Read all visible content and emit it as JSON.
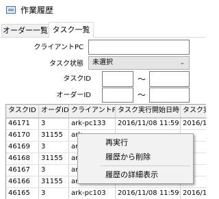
{
  "window": {
    "title": "作業履歴",
    "icon": "window-app-icon"
  },
  "tabs": [
    {
      "label": "オーダー一覧",
      "active": false
    },
    {
      "label": "タスク一覧",
      "active": true
    }
  ],
  "filters": {
    "client_pc_label": "クライアントPC",
    "client_pc_value": "",
    "task_status_label": "タスク状態",
    "task_status_value": "未選択",
    "task_id_label": "タスクID",
    "order_id_label": "オーダーID",
    "range_separator": "～",
    "task_id_from": "",
    "task_id_to": "",
    "order_id_from": "",
    "order_id_to": ""
  },
  "grid": {
    "columns": [
      "タスクID",
      "オーダID",
      "クライアントPC",
      "タスク実行開始日時",
      "タスク実行"
    ],
    "rows": [
      [
        "46171",
        "3",
        "ark-pc133",
        "2016/11/08 11:59:29",
        "2016/11/0"
      ],
      [
        "46170",
        "31155",
        "ark-",
        "",
        ""
      ],
      [
        "46169",
        "3",
        "ark-",
        "",
        ""
      ],
      [
        "46168",
        "31155",
        "ark-",
        "",
        ""
      ],
      [
        "46167",
        "3",
        "ark-",
        "",
        ""
      ],
      [
        "46166",
        "31155",
        "ark-",
        "",
        ""
      ],
      [
        "46165",
        "3",
        "ark-pc103",
        "2016/11/08 11:59:29",
        "2016/11/0"
      ]
    ]
  },
  "context_menu": {
    "items": [
      "再実行",
      "履歴から削除",
      "履歴の詳細表示"
    ]
  }
}
